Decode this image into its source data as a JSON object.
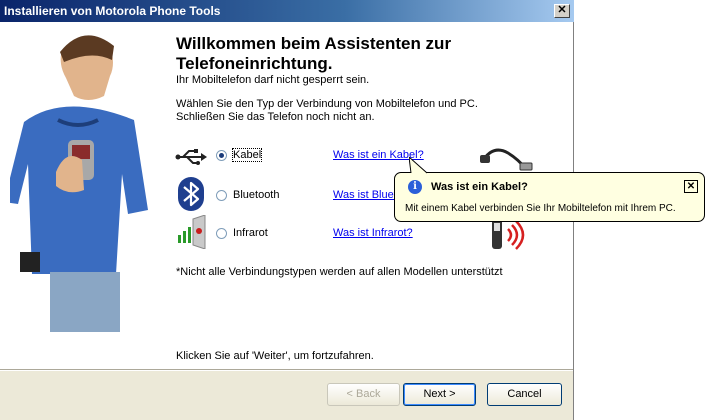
{
  "window": {
    "title": "Installieren von Motorola Phone Tools",
    "close_symbol": "✕"
  },
  "main": {
    "title": "Willkommen beim Assistenten zur Telefoneinrichtung.",
    "warning": "Ihr Mobiltelefon darf nicht gesperrt sein.",
    "instruction_line1": "Wählen Sie den Typ der Verbindung von Mobiltelefon und PC.",
    "instruction_line2": "Schließen Sie das Telefon noch nicht an.",
    "options": [
      {
        "label": "Kabel",
        "selected": true,
        "icon": "usb-icon",
        "link": "Was ist ein Kabel?"
      },
      {
        "label": "Bluetooth",
        "selected": false,
        "icon": "bluetooth-icon",
        "link": "Was ist Bluetooth?"
      },
      {
        "label": "Infrarot",
        "selected": false,
        "icon": "infrared-icon",
        "link": "Was ist Infrarot?"
      }
    ],
    "footnote": "*Nicht alle Verbindungstypen werden auf allen Modellen unterstützt",
    "continue_hint": "Klicken Sie auf 'Weiter', um fortzufahren."
  },
  "buttons": {
    "back": "< Back",
    "next": "Next >",
    "cancel": "Cancel"
  },
  "tooltip": {
    "title": "Was ist ein Kabel?",
    "text": "Mit einem Kabel verbinden Sie Ihr Mobiltelefon mit Ihrem PC.",
    "icon": "info-icon",
    "close_symbol": "✕"
  },
  "colors": {
    "title_bar": "#0a246a",
    "link": "#0000ee",
    "tooltip_bg": "#ffffe1"
  }
}
